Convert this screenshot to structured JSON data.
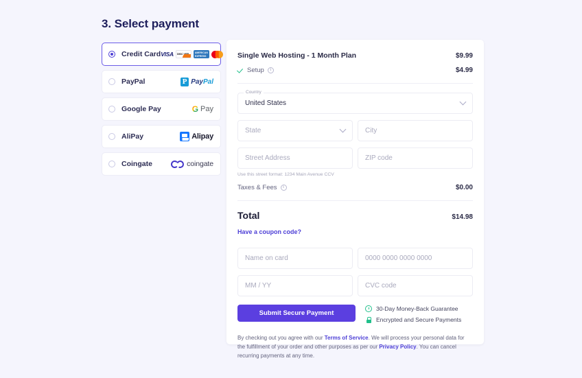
{
  "heading": "3. Select payment",
  "payment_methods": [
    {
      "id": "credit-card",
      "label": "Credit Card",
      "selected": true,
      "logos": [
        "visa-logo",
        "discover-logo",
        "amex-logo",
        "mastercard-logo"
      ]
    },
    {
      "id": "paypal",
      "label": "PayPal",
      "selected": false,
      "logos": [
        "paypal-logo"
      ]
    },
    {
      "id": "google-pay",
      "label": "Google Pay",
      "selected": false,
      "logos": [
        "google-pay-logo"
      ]
    },
    {
      "id": "alipay",
      "label": "AliPay",
      "selected": false,
      "logos": [
        "alipay-logo"
      ]
    },
    {
      "id": "coingate",
      "label": "Coingate",
      "selected": false,
      "logos": [
        "coingate-logo"
      ]
    }
  ],
  "brand_text": {
    "visa": "VISA",
    "paypal_pay": "Pay",
    "paypal_pal": "Pal",
    "gpay_g": "G",
    "gpay_pay": "Pay",
    "alipay": "Alipay",
    "coingate": "coingate"
  },
  "summary": {
    "plan_name": "Single Web Hosting - 1 Month Plan",
    "plan_price": "$9.99",
    "setup_label": "Setup",
    "setup_price": "$4.99",
    "taxes_label": "Taxes & Fees",
    "taxes_price": "$0.00",
    "total_label": "Total",
    "total_price": "$14.98",
    "coupon_link": "Have a coupon code?"
  },
  "address_form": {
    "country_label": "Country",
    "country_value": "United States",
    "state_placeholder": "State",
    "city_placeholder": "City",
    "street_placeholder": "Street Address",
    "zip_placeholder": "ZIP code",
    "street_hint": "Use this street format: 1234 Main Avenue CCV"
  },
  "card_form": {
    "name_placeholder": "Name on card",
    "number_placeholder": "0000 0000 0000 0000",
    "expiry_placeholder": "MM / YY",
    "cvc_placeholder": "CVC code",
    "submit_label": "Submit Secure Payment"
  },
  "assurances": [
    {
      "icon": "refund-clock-icon",
      "label": "30-Day Money-Back Guarantee"
    },
    {
      "icon": "lock-icon",
      "label": "Encrypted and Secure Payments"
    }
  ],
  "legal": {
    "part1": "By checking out you agree with our ",
    "terms_link": "Terms of Service",
    "part2": ". We will process your personal data for the fulfillment of your order and other purposes as per our ",
    "privacy_link": "Privacy Policy",
    "part3": ". You can cancel recurring payments at any time."
  },
  "colors": {
    "page_background": "#f5f5fd",
    "accent": "#4d3fd6",
    "button": "#5b3fe0",
    "heading": "#1d1e5b",
    "success": "#21c08b"
  }
}
